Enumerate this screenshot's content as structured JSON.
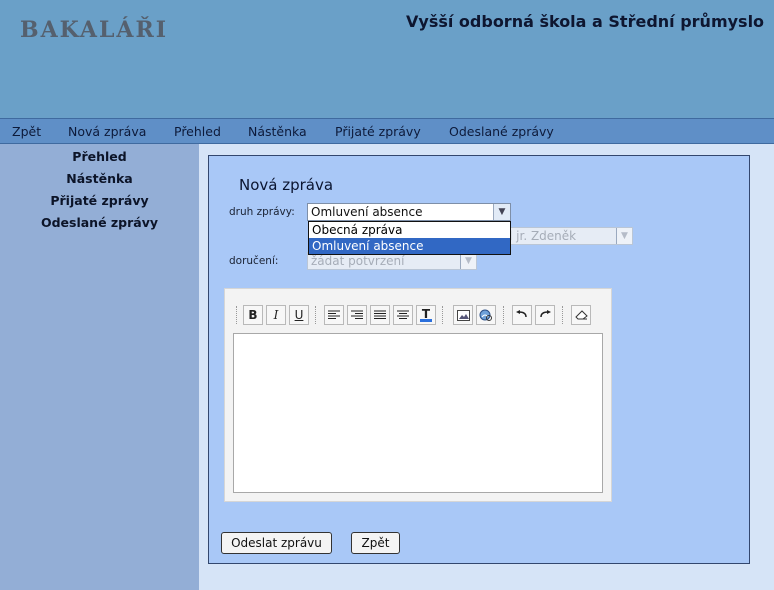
{
  "header": {
    "logo": "BAKALÁŘI",
    "school": "Vyšší odborná škola a Střední průmyslo"
  },
  "menu": [
    "Zpět",
    "Nová zpráva",
    "Přehled",
    "Nástěnka",
    "Přijaté zprávy",
    "Odeslané zprávy"
  ],
  "sidebar": [
    "Přehled",
    "Nástěnka",
    "Přijaté zprávy",
    "Odeslané zprávy"
  ],
  "form": {
    "title": "Nová zpráva",
    "druh_label": "druh zprávy:",
    "druh_value": "Omluvení absence",
    "dropdown_options": [
      "Obecná zpráva",
      "Omluvení absence"
    ],
    "selected_option": "Omluvení absence",
    "komu_value": "Ing. Novák jr. Zdeněk",
    "komu_visible": "l jr. Zdeněk",
    "doruceni_label": "doručení:",
    "doruceni_value": "žádat potvrzení"
  },
  "toolbar": {
    "bold": "B",
    "italic": "I",
    "underline": "U",
    "text_color": "T"
  },
  "buttons": {
    "send": "Odeslat zprávu",
    "back": "Zpět"
  },
  "icons": [
    "bold-icon",
    "italic-icon",
    "underline-icon",
    "align-left-icon",
    "align-right-icon",
    "align-justify-icon",
    "align-center-icon",
    "text-color-icon",
    "image-icon",
    "link-icon",
    "undo-icon",
    "redo-icon",
    "eraser-icon"
  ]
}
